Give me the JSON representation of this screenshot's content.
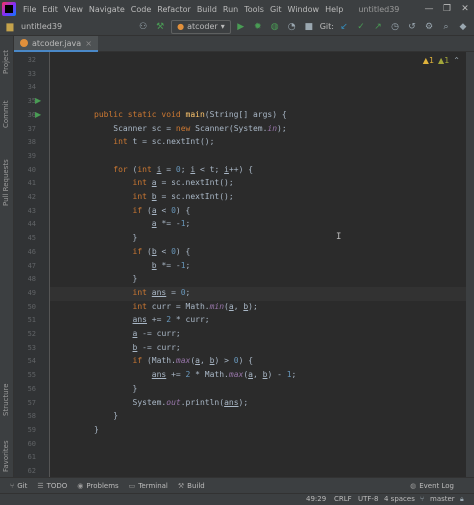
{
  "menu": {
    "items": [
      "File",
      "Edit",
      "View",
      "Navigate",
      "Code",
      "Refactor",
      "Build",
      "Run",
      "Tools",
      "Git",
      "Window",
      "Help"
    ],
    "title": "untitled39"
  },
  "toolbar": {
    "project": "untitled39",
    "run_config": "atcoder",
    "git_label": "Git:"
  },
  "tabs": [
    {
      "label": "atcoder.java",
      "active": true
    }
  ],
  "left_tools": [
    "Project",
    "Commit",
    "Pull Requests",
    "Structure",
    "Favorites"
  ],
  "inspections": {
    "warnings": "1",
    "weak_warnings": "1"
  },
  "cursor_glyph": "I",
  "editor": {
    "caret_line": 49,
    "run_marker_lines": [
      35,
      36
    ],
    "lines": [
      {
        "n": "32",
        "tokens": []
      },
      {
        "n": "33",
        "tokens": []
      },
      {
        "n": "34",
        "tokens": []
      },
      {
        "n": "35",
        "tokens": []
      },
      {
        "n": "36",
        "tokens": [
          [
            "kw",
            "public static void "
          ],
          [
            "fn",
            "main"
          ],
          [
            "plain",
            "(String[] args) {"
          ]
        ]
      },
      {
        "n": "37",
        "tokens": [
          [
            "plain",
            "    Scanner sc = "
          ],
          [
            "kw",
            "new "
          ],
          [
            "plain",
            "Scanner(System."
          ],
          [
            "static",
            "in"
          ],
          [
            "plain",
            ");"
          ]
        ]
      },
      {
        "n": "38",
        "tokens": [
          [
            "kw",
            "    int "
          ],
          [
            "plain",
            "t = sc.nextInt();"
          ]
        ]
      },
      {
        "n": "39",
        "tokens": []
      },
      {
        "n": "40",
        "tokens": [
          [
            "kw",
            "    for "
          ],
          [
            "plain",
            "("
          ],
          [
            "kw",
            "int "
          ],
          [
            "var",
            "i"
          ],
          [
            "plain",
            " = "
          ],
          [
            "num",
            "0"
          ],
          [
            "plain",
            "; "
          ],
          [
            "var",
            "i"
          ],
          [
            "plain",
            " < t; "
          ],
          [
            "var",
            "i"
          ],
          [
            "plain",
            "++) {"
          ]
        ]
      },
      {
        "n": "41",
        "tokens": [
          [
            "kw",
            "        int "
          ],
          [
            "var",
            "a"
          ],
          [
            "plain",
            " = sc.nextInt();"
          ]
        ]
      },
      {
        "n": "42",
        "tokens": [
          [
            "kw",
            "        int "
          ],
          [
            "var",
            "b"
          ],
          [
            "plain",
            " = sc.nextInt();"
          ]
        ]
      },
      {
        "n": "43",
        "tokens": [
          [
            "kw",
            "        if "
          ],
          [
            "plain",
            "("
          ],
          [
            "var",
            "a"
          ],
          [
            "plain",
            " < "
          ],
          [
            "num",
            "0"
          ],
          [
            "plain",
            ") {"
          ]
        ]
      },
      {
        "n": "44",
        "tokens": [
          [
            "plain",
            "            "
          ],
          [
            "var",
            "a"
          ],
          [
            "plain",
            " *= -"
          ],
          [
            "num",
            "1"
          ],
          [
            "plain",
            ";"
          ]
        ]
      },
      {
        "n": "45",
        "tokens": [
          [
            "plain",
            "        }"
          ]
        ]
      },
      {
        "n": "46",
        "tokens": [
          [
            "kw",
            "        if "
          ],
          [
            "plain",
            "("
          ],
          [
            "var",
            "b"
          ],
          [
            "plain",
            " < "
          ],
          [
            "num",
            "0"
          ],
          [
            "plain",
            ") {"
          ]
        ]
      },
      {
        "n": "47",
        "tokens": [
          [
            "plain",
            "            "
          ],
          [
            "var",
            "b"
          ],
          [
            "plain",
            " *= -"
          ],
          [
            "num",
            "1"
          ],
          [
            "plain",
            ";"
          ]
        ]
      },
      {
        "n": "48",
        "tokens": [
          [
            "plain",
            "        }"
          ]
        ]
      },
      {
        "n": "49",
        "tokens": [
          [
            "kw",
            "        int "
          ],
          [
            "var",
            "ans"
          ],
          [
            "plain",
            " = "
          ],
          [
            "num",
            "0"
          ],
          [
            "plain",
            ";"
          ]
        ]
      },
      {
        "n": "50",
        "tokens": [
          [
            "kw",
            "        int "
          ],
          [
            "plain",
            "curr = Math."
          ],
          [
            "static",
            "min"
          ],
          [
            "plain",
            "("
          ],
          [
            "var",
            "a"
          ],
          [
            "plain",
            ", "
          ],
          [
            "var",
            "b"
          ],
          [
            "plain",
            ");"
          ]
        ]
      },
      {
        "n": "51",
        "tokens": [
          [
            "plain",
            "        "
          ],
          [
            "var",
            "ans"
          ],
          [
            "plain",
            " += "
          ],
          [
            "num",
            "2"
          ],
          [
            "plain",
            " * curr;"
          ]
        ]
      },
      {
        "n": "52",
        "tokens": [
          [
            "plain",
            "        "
          ],
          [
            "var",
            "a"
          ],
          [
            "plain",
            " -= curr;"
          ]
        ]
      },
      {
        "n": "53",
        "tokens": [
          [
            "plain",
            "        "
          ],
          [
            "var",
            "b"
          ],
          [
            "plain",
            " -= curr;"
          ]
        ]
      },
      {
        "n": "54",
        "tokens": [
          [
            "kw",
            "        if "
          ],
          [
            "plain",
            "(Math."
          ],
          [
            "static",
            "max"
          ],
          [
            "plain",
            "("
          ],
          [
            "var",
            "a"
          ],
          [
            "plain",
            ", "
          ],
          [
            "var",
            "b"
          ],
          [
            "plain",
            ") > "
          ],
          [
            "num",
            "0"
          ],
          [
            "plain",
            ") {"
          ]
        ]
      },
      {
        "n": "55",
        "tokens": [
          [
            "plain",
            "            "
          ],
          [
            "var",
            "ans"
          ],
          [
            "plain",
            " += "
          ],
          [
            "num",
            "2"
          ],
          [
            "plain",
            " * Math."
          ],
          [
            "static",
            "max"
          ],
          [
            "plain",
            "("
          ],
          [
            "var",
            "a"
          ],
          [
            "plain",
            ", "
          ],
          [
            "var",
            "b"
          ],
          [
            "plain",
            ") - "
          ],
          [
            "num",
            "1"
          ],
          [
            "plain",
            ";"
          ]
        ]
      },
      {
        "n": "56",
        "tokens": [
          [
            "plain",
            "        }"
          ]
        ]
      },
      {
        "n": "57",
        "tokens": [
          [
            "plain",
            "        System."
          ],
          [
            "static",
            "out"
          ],
          [
            "plain",
            ".println("
          ],
          [
            "var",
            "ans"
          ],
          [
            "plain",
            ");"
          ]
        ]
      },
      {
        "n": "58",
        "tokens": [
          [
            "plain",
            "    }"
          ]
        ]
      },
      {
        "n": "59",
        "tokens": [
          [
            "plain",
            "}"
          ]
        ]
      },
      {
        "n": "60",
        "tokens": []
      },
      {
        "n": "61",
        "tokens": []
      },
      {
        "n": "62",
        "tokens": []
      }
    ]
  },
  "bottom_tools": [
    {
      "label": "Git",
      "icon": "git-branch-icon"
    },
    {
      "label": "TODO",
      "icon": "todo-list-icon"
    },
    {
      "label": "Problems",
      "icon": "problems-icon"
    },
    {
      "label": "Terminal",
      "icon": "terminal-icon"
    },
    {
      "label": "Build",
      "icon": "hammer-icon"
    }
  ],
  "event_log": "Event Log",
  "status": {
    "position": "49:29",
    "line_sep": "CRLF",
    "encoding": "UTF-8",
    "indent": "4 spaces",
    "branch": "master"
  }
}
